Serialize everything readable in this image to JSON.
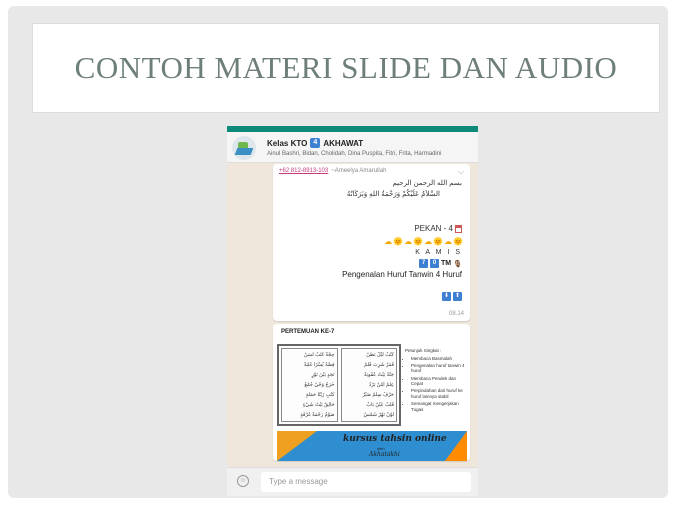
{
  "slide": {
    "title": "CONTOH MATERI SLIDE DAN AUDIO"
  },
  "chat": {
    "group_name": "Kelas KTO",
    "group_badge": "4",
    "group_suffix": "AKHAWAT",
    "members": "Ainul Bashri, Bidan, Cholidah, Dina Puspita, Fitri, Frita, Harmadini",
    "accent_color": "#0e8a7a"
  },
  "message1": {
    "sender_phone": "+62 812-8913-103",
    "sender_name": "~Ameelya Amarullah",
    "arabic_line1": "بسم الله الرحمن الرحيم",
    "arabic_line2": "السَّلاَمُ عَلَيْكُمْ وَرَحْمَةُ اللهِ وَبَرَكَاتُهُ",
    "pekan": "PEKAN - 4",
    "weather": "☁🌞☁🌞☁🌞☁🌞",
    "day": "K A M I S",
    "tm_badge1": "7",
    "tm_badge2": "0",
    "tm_label": "TM",
    "topic": "Pengenalan Huruf Tanwin 4 Huruf",
    "arrow_down": "⬇",
    "arrow_up": "⬆",
    "time": "08.14"
  },
  "message2": {
    "heading": "PERTEMUAN KE-7",
    "arabic_rows_col1": [
      "حِجَّةً كَلْبٌ لَسَنٌ",
      "فِضَّةً يُسْرًا غَلَبَةً",
      "نَجَدٍ بَيْنَ نَوْرٍ",
      "خَرَجٌ وَحْيٌ جُمُعٌ",
      "كُتُبٍ زَيْتًا حَمَلَةٍ",
      "حَالِقٌ بَيْتٌ شَيْءٍ",
      "صَوْمٌ رَحْمَةٌ غَرْفَةٍ"
    ],
    "arabic_rows_col2": [
      "كُتُبٌ لَيْلٌ بَطْنٌ",
      "قَمَرٌ شَرِبَ قَلَمٌ",
      "جَنَّةٌ بَيْتٌ عُقُوبَةٌ",
      "عِلْمٌ أَمْنٌ بَرْدٌ",
      "حَرْفٌ سِلْمٌ صَبْرٌ",
      "قَلْبٌ عَيْنٌ بَابٌ",
      "لَوْنٌ نَهْرٌ شَمْسٌ"
    ],
    "instructions_heading": "Petunjuk Singkat :",
    "instructions": [
      "Membaca Basmalah",
      "Pengenalan huruf tanwin 4 huruf",
      "Membaca Pendek dan Cepat",
      "Perpindahan dari huruf ke huruf lainnya stabil",
      "Semangat mengerjakan Tugas"
    ],
    "banner_title": "kursus tahsin online",
    "banner_sub": "oleh",
    "banner_brand": "Akhatakhi"
  },
  "input": {
    "placeholder": "Type a message",
    "emoji_icon": "emoji-icon"
  }
}
